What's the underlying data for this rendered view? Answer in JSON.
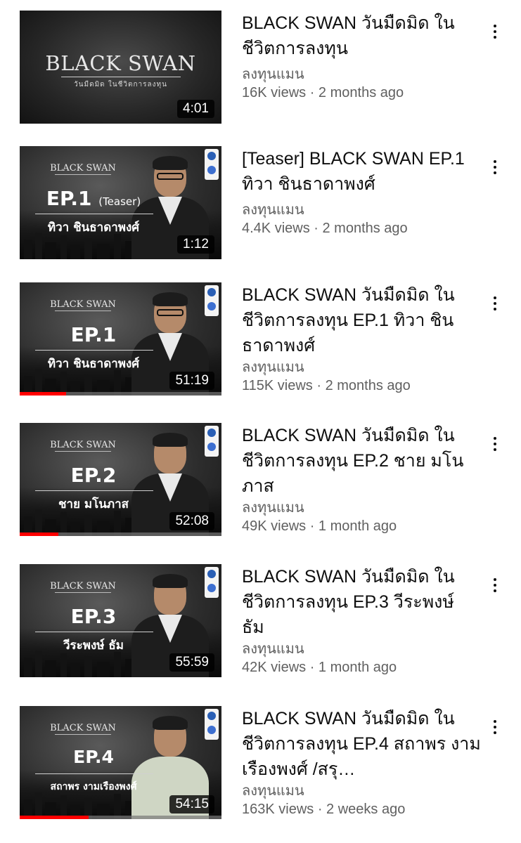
{
  "videos": [
    {
      "title": "BLACK SWAN วันมืดมิด ในชีวิตการลงทุน",
      "channel": "ลงทุนแมน",
      "stats": "16K views · 2 months ago",
      "duration": "4:01",
      "thumbnail": {
        "logo_text": "BLACK SWAN",
        "logo_subtext": "วันมืดมิด ในชีวิตการลงทุน"
      },
      "progress": 0
    },
    {
      "title": "[Teaser] BLACK SWAN EP.1 ทิวา ชินธาดาพงศ์",
      "channel": "ลงทุนแมน",
      "stats": "4.4K views · 2 months ago",
      "duration": "1:12",
      "thumbnail": {
        "logo_text": "BLACK SWAN",
        "episode": "EP.1",
        "tag": "(Teaser)",
        "guest": "ทิวา ชินธาดาพงศ์"
      },
      "progress": 0
    },
    {
      "title": "BLACK SWAN วันมืดมิด ในชีวิตการลงทุน EP.1 ทิวา ชินธาดาพงศ์",
      "channel": "ลงทุนแมน",
      "stats": "115K views · 2 months ago",
      "duration": "51:19",
      "thumbnail": {
        "logo_text": "BLACK SWAN",
        "episode": "EP.1",
        "guest": "ทิวา ชินธาดาพงศ์"
      },
      "progress": 0.23
    },
    {
      "title": "BLACK SWAN วันมืดมิด ในชีวิตการลงทุน EP.2 ชาย มโนภาส",
      "channel": "ลงทุนแมน",
      "stats": "49K views · 1 month ago",
      "duration": "52:08",
      "thumbnail": {
        "logo_text": "BLACK SWAN",
        "episode": "EP.2",
        "guest": "ชาย มโนภาส"
      },
      "progress": 0.19
    },
    {
      "title": "BLACK SWAN วันมืดมิด ในชีวิตการลงทุน EP.3 วีระพงษ์ ธัม",
      "channel": "ลงทุนแมน",
      "stats": "42K views · 1 month ago",
      "duration": "55:59",
      "thumbnail": {
        "logo_text": "BLACK SWAN",
        "episode": "EP.3",
        "guest": "วีระพงษ์ ธัม"
      },
      "progress": 0
    },
    {
      "title": "BLACK SWAN วันมืดมิด ในชีวิตการลงทุน EP.4 สถาพร งามเรืองพงศ์ /สรุ…",
      "channel": "ลงทุนแมน",
      "stats": "163K views · 2 weeks ago",
      "duration": "54:15",
      "thumbnail": {
        "logo_text": "BLACK SWAN",
        "episode": "EP.4",
        "guest": "สถาพร งามเรืองพงศ์"
      },
      "progress": 0.34
    }
  ]
}
